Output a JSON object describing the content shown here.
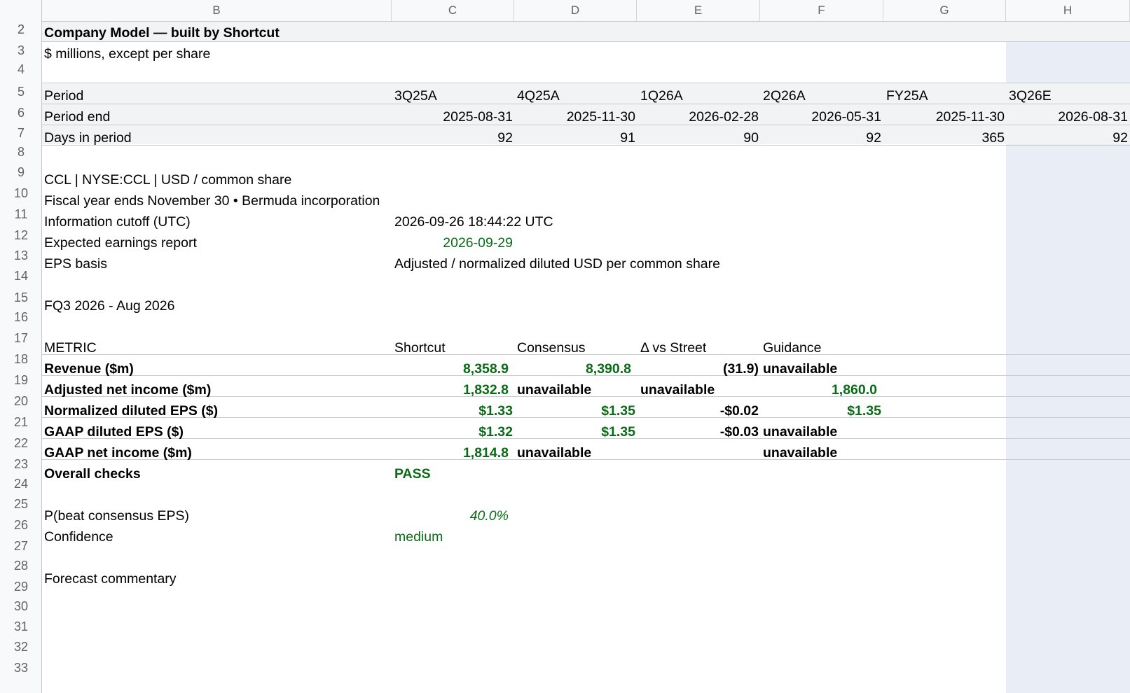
{
  "columns": [
    "B",
    "C",
    "D",
    "E",
    "F",
    "G",
    "H"
  ],
  "rows": [
    "2",
    "3",
    "4",
    "5",
    "6",
    "7",
    "8",
    "9",
    "10",
    "11",
    "12",
    "13",
    "14",
    "15",
    "16",
    "17",
    "18",
    "19",
    "20",
    "21",
    "22",
    "23",
    "24",
    "25",
    "26",
    "27",
    "28",
    "29",
    "30",
    "31",
    "32",
    "33"
  ],
  "title": "Company Model — built by Shortcut",
  "subtitle": "$ millions, except per share",
  "period_rows": {
    "period_label": "Period",
    "periods": [
      "3Q25A",
      "4Q25A",
      "1Q26A",
      "2Q26A",
      "FY25A",
      "3Q26E"
    ],
    "period_end_label": "Period end",
    "period_ends": [
      "2025-08-31",
      "2025-11-30",
      "2026-02-28",
      "2026-05-31",
      "2025-11-30",
      "2026-08-31"
    ],
    "days_label": "Days in period",
    "days": [
      "92",
      "91",
      "90",
      "92",
      "365",
      "92"
    ]
  },
  "info": {
    "ticker_line": "CCL  |  NYSE:CCL  |  USD / common share",
    "fiscal_line": "Fiscal year ends November 30  •  Bermuda incorporation",
    "cutoff_label": "Information cutoff (UTC)",
    "cutoff_value": "2026-09-26 18:44:22 UTC",
    "earnings_label": "Expected earnings report",
    "earnings_value": "2026-09-29",
    "eps_basis_label": "EPS basis",
    "eps_basis_value": "Adjusted / normalized diluted USD per common share"
  },
  "quarter_label": "FQ3 2026 - Aug 2026",
  "metrics": {
    "headers": [
      "METRIC",
      "Shortcut",
      "Consensus",
      "Δ vs Street",
      "Guidance"
    ],
    "rows": [
      {
        "name": "Revenue ($m)",
        "shortcut": "8,358.9",
        "consensus": "8,390.8",
        "delta": "(31.9)",
        "guidance": "unavailable"
      },
      {
        "name": "Adjusted net income ($m)",
        "shortcut": "1,832.8",
        "consensus": "unavailable",
        "delta": "unavailable",
        "guidance": "1,860.0"
      },
      {
        "name": "Normalized diluted EPS ($)",
        "shortcut": "$1.33",
        "consensus": "$1.35",
        "delta": "-$0.02",
        "guidance": "$1.35"
      },
      {
        "name": "GAAP diluted EPS ($)",
        "shortcut": "$1.32",
        "consensus": "$1.35",
        "delta": "-$0.03",
        "guidance": "unavailable"
      },
      {
        "name": "GAAP net income ($m)",
        "shortcut": "1,814.8",
        "consensus": "unavailable",
        "delta": "",
        "guidance": "unavailable"
      }
    ],
    "overall_label": "Overall checks",
    "overall_value": "PASS"
  },
  "probability": {
    "label": "P(beat consensus EPS)",
    "value": "40.0%",
    "confidence_label": "Confidence",
    "confidence_value": "medium"
  },
  "commentary_label": "Forecast commentary",
  "colors": {
    "positive_green": "#0a6b16",
    "header_band": "#f1f3f4",
    "selected_column": "#e8edf6"
  }
}
